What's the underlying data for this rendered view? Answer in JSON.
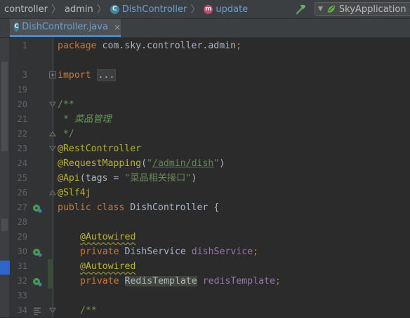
{
  "breadcrumb": {
    "items": [
      "controller",
      "admin",
      "DishController",
      "update"
    ],
    "class_badge": "C",
    "method_badge": "m"
  },
  "toolbar": {
    "run_config_label": "SkyApplication"
  },
  "tab": {
    "badge": "C",
    "label": "DishController.java",
    "close": "×"
  },
  "editor": {
    "lines": [
      {
        "n": "1"
      },
      {
        "n": "3"
      },
      {
        "n": "19"
      },
      {
        "n": "20"
      },
      {
        "n": "21"
      },
      {
        "n": "22"
      },
      {
        "n": "23"
      },
      {
        "n": "24"
      },
      {
        "n": "25"
      },
      {
        "n": "26"
      },
      {
        "n": "27"
      },
      {
        "n": "28"
      },
      {
        "n": "29"
      },
      {
        "n": "30"
      },
      {
        "n": "31"
      },
      {
        "n": "32"
      },
      {
        "n": "33"
      },
      {
        "n": "34"
      }
    ],
    "tokens": {
      "l1_kw": "package",
      "l1_rest": " com.sky.controller.admin",
      "l1_semi": ";",
      "l3_kw": "import",
      "l3_dots": "...",
      "l20": "/**",
      "l21": " * 菜品管理",
      "l22": " */",
      "l23": "@RestController",
      "l24_ann": "@RequestMapping",
      "l24_open": "(",
      "l24_q1": "\"",
      "l24_path": "/admin/dish",
      "l24_q2": "\"",
      "l24_close": ")",
      "l25_ann": "@Api",
      "l25_mid": "(tags = ",
      "l25_str": "\"菜品相关接口\"",
      "l25_close": ")",
      "l26": "@Slf4j",
      "l27_kw": "public class",
      "l27_rest": " DishController {",
      "l29": "@Autowired",
      "l30_kw": "private",
      "l30_type": " DishService ",
      "l30_field": "dishService",
      "l30_semi": ";",
      "l31": "@Autowired",
      "l32_kw": "private",
      "l32_type": "RedisTemplate",
      "l32_field": "redisTemplate",
      "l32_semi": ";",
      "l34": "/**"
    }
  },
  "colors": {
    "keyword": "#cc7832",
    "annotation": "#bbb529",
    "string": "#6a8759",
    "comment": "#629755",
    "field": "#9876aa",
    "accent": "#4a88c7"
  },
  "icons": {
    "class_badge": "class-c-icon",
    "method_badge": "method-m-icon",
    "build": "hammer-icon",
    "run_config": "spring-boot-icon",
    "bean": "spring-bean-icon",
    "fold": "fold-icon"
  }
}
